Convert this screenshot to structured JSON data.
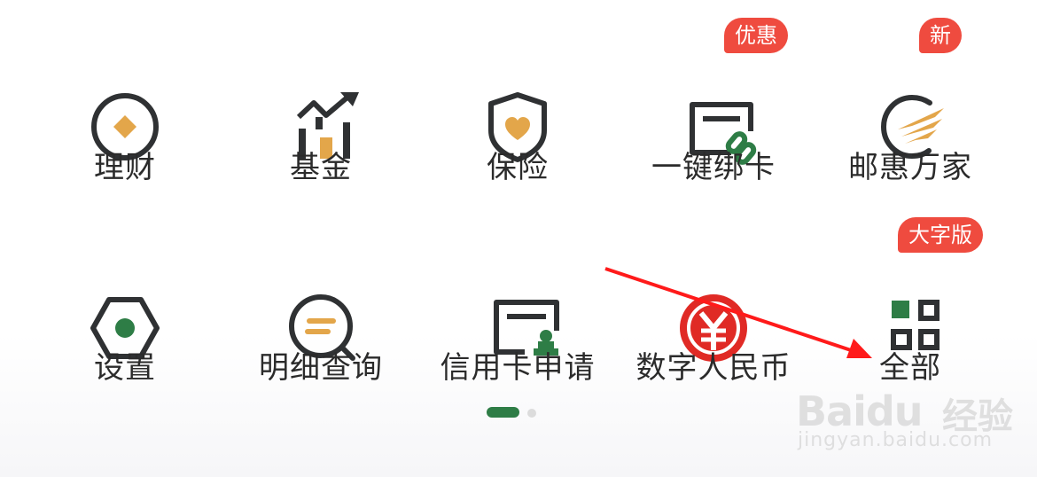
{
  "grid": {
    "row1": [
      {
        "label": "理财",
        "icon": "wealth-diamond-icon"
      },
      {
        "label": "基金",
        "icon": "fund-chart-icon"
      },
      {
        "label": "保险",
        "icon": "insurance-shield-icon"
      },
      {
        "label": "一键绑卡",
        "icon": "bind-card-link-icon",
        "badge": "优惠"
      },
      {
        "label": "邮惠万家",
        "icon": "postal-benefit-logo-icon",
        "badge": "新"
      }
    ],
    "row2": [
      {
        "label": "设置",
        "icon": "settings-hexagon-icon"
      },
      {
        "label": "明细查询",
        "icon": "details-search-icon"
      },
      {
        "label": "信用卡申请",
        "icon": "credit-card-apply-icon"
      },
      {
        "label": "数字人民币",
        "icon": "digital-rmb-icon"
      },
      {
        "label": "全部",
        "icon": "all-apps-grid-icon",
        "badge": "大字版"
      }
    ]
  },
  "pager": {
    "active_index": 0,
    "page_count": 2
  },
  "watermark": {
    "brand": "Baidu",
    "cn": "经验",
    "url": "jingyan.baidu.com"
  },
  "colors": {
    "accent_green": "#2e7d46",
    "gold": "#e3a64a",
    "badge_red": "#ef4b3f",
    "icon_dark": "#2f3133",
    "rmb_red": "#e02a25",
    "arrow_red": "#ff1a1a"
  }
}
